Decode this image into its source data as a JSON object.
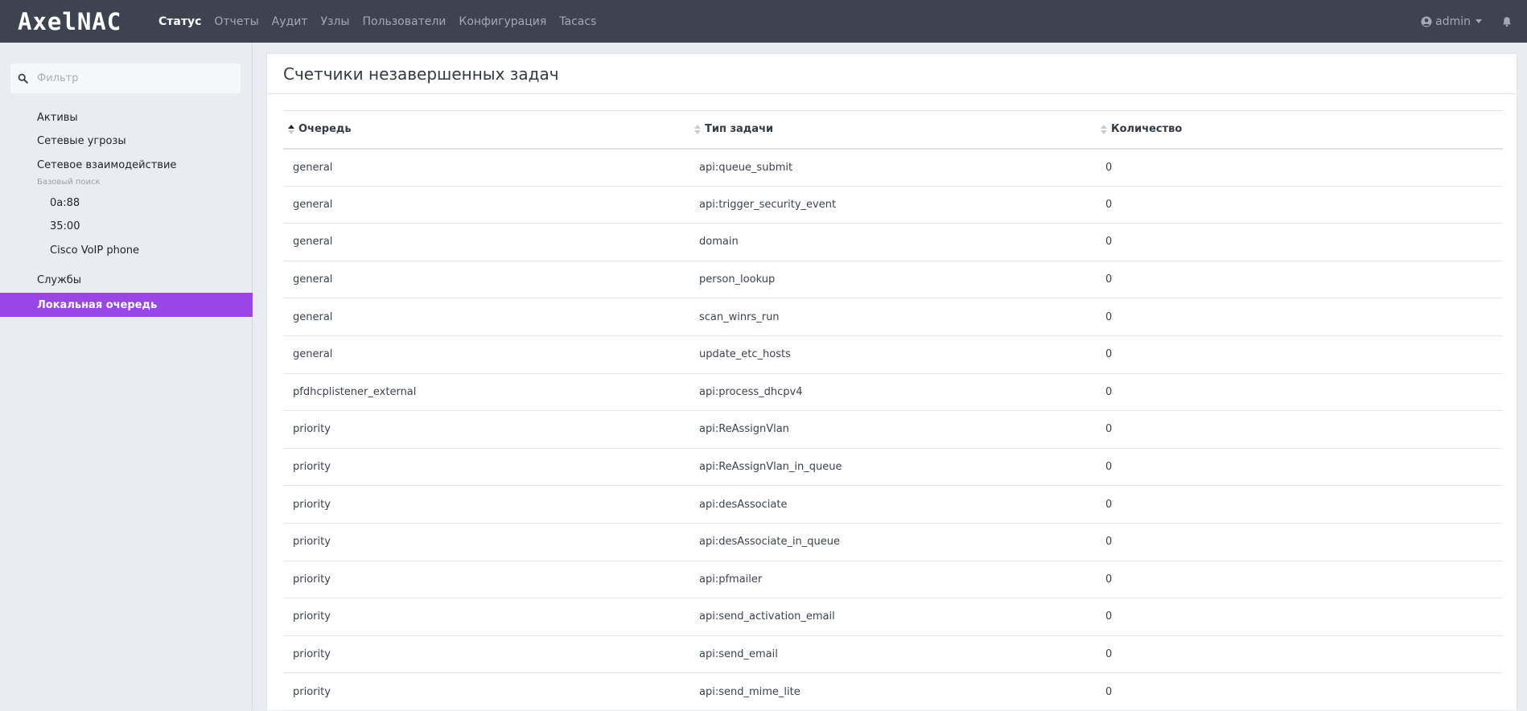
{
  "brand": "AxelNAC",
  "nav": {
    "items": [
      {
        "label": "Статус",
        "active": true
      },
      {
        "label": "Отчеты",
        "active": false
      },
      {
        "label": "Аудит",
        "active": false
      },
      {
        "label": "Узлы",
        "active": false
      },
      {
        "label": "Пользователи",
        "active": false
      },
      {
        "label": "Конфигурация",
        "active": false
      },
      {
        "label": "Tacacs",
        "active": false
      }
    ],
    "user": "admin",
    "icons": {
      "user": "user-circle-icon",
      "bell": "bell-icon",
      "caret": "caret-down-icon"
    }
  },
  "sidebar": {
    "filter_placeholder": "Фильтр",
    "items": [
      {
        "label": "Активы"
      },
      {
        "label": "Сетевые угрозы"
      },
      {
        "label": "Сетевое взаимодействие"
      }
    ],
    "group_label": "Базовый поиск",
    "sub_items": [
      {
        "label": "0a:88"
      },
      {
        "label": "35:00"
      },
      {
        "label": "Cisco VoIP phone"
      }
    ],
    "services": "Службы",
    "active_item": "Локальная очередь",
    "accent_color": "#9a46e6"
  },
  "main": {
    "title": "Счетчики незавершенных задач",
    "columns": [
      "Очередь",
      "Тип задачи",
      "Количество"
    ],
    "sorted_column": "Очередь",
    "sort_direction": "asc",
    "rows": [
      {
        "queue": "general",
        "task": "api:queue_submit",
        "count": "0"
      },
      {
        "queue": "general",
        "task": "api:trigger_security_event",
        "count": "0"
      },
      {
        "queue": "general",
        "task": "domain",
        "count": "0"
      },
      {
        "queue": "general",
        "task": "person_lookup",
        "count": "0"
      },
      {
        "queue": "general",
        "task": "scan_winrs_run",
        "count": "0"
      },
      {
        "queue": "general",
        "task": "update_etc_hosts",
        "count": "0"
      },
      {
        "queue": "pfdhcplistener_external",
        "task": "api:process_dhcpv4",
        "count": "0"
      },
      {
        "queue": "priority",
        "task": "api:ReAssignVlan",
        "count": "0"
      },
      {
        "queue": "priority",
        "task": "api:ReAssignVlan_in_queue",
        "count": "0"
      },
      {
        "queue": "priority",
        "task": "api:desAssociate",
        "count": "0"
      },
      {
        "queue": "priority",
        "task": "api:desAssociate_in_queue",
        "count": "0"
      },
      {
        "queue": "priority",
        "task": "api:pfmailer",
        "count": "0"
      },
      {
        "queue": "priority",
        "task": "api:send_activation_email",
        "count": "0"
      },
      {
        "queue": "priority",
        "task": "api:send_email",
        "count": "0"
      },
      {
        "queue": "priority",
        "task": "api:send_mime_lite",
        "count": "0"
      }
    ]
  }
}
